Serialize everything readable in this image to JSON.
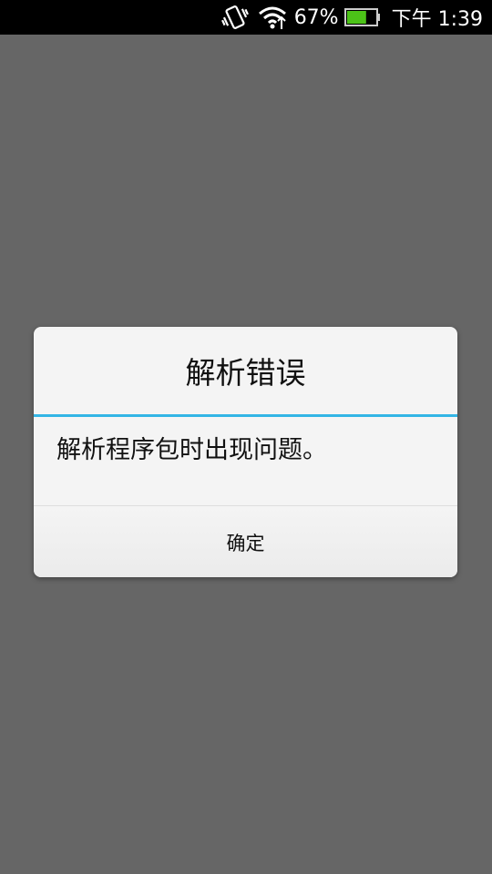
{
  "status_bar": {
    "icons": [
      "vibrate-icon",
      "wifi-icon",
      "battery-icon"
    ],
    "battery_percent": "67%",
    "time": "下午 1:39",
    "battery_level": 0.67,
    "battery_color": "#4cc318"
  },
  "dialog": {
    "title": "解析错误",
    "message": "解析程序包时出现问题。",
    "ok_label": "确定",
    "accent_color": "#33b5e5"
  }
}
